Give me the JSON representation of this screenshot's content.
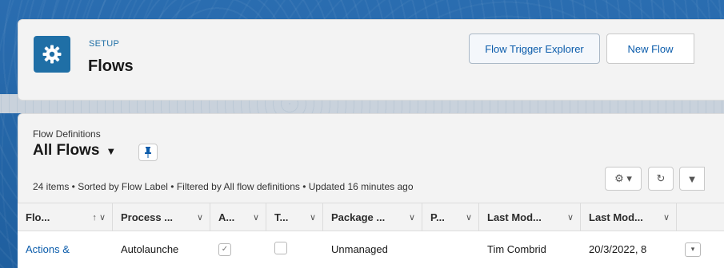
{
  "header": {
    "section_label": "SETUP",
    "title": "Flows",
    "buttons": {
      "trigger_explorer": "Flow Trigger Explorer",
      "new_flow": "New Flow"
    }
  },
  "list_view": {
    "object_label": "Flow Definitions",
    "title": "All Flows",
    "caret": "▼",
    "pin_icon": "📌",
    "meta": "24 items • Sorted by Flow Label • Filtered by All flow definitions • Updated 16 minutes ago",
    "tools": {
      "gear": "⚙ ▾",
      "refresh": "↻",
      "filter": "▼"
    }
  },
  "table": {
    "columns": [
      {
        "label": "Flo...",
        "sort": "↑",
        "chev": "∨"
      },
      {
        "label": "Process ...",
        "chev": "∨"
      },
      {
        "label": "A...",
        "chev": "∨"
      },
      {
        "label": "T...",
        "chev": "∨"
      },
      {
        "label": "Package ...",
        "chev": "∨"
      },
      {
        "label": "P...",
        "chev": "∨"
      },
      {
        "label": "Last Mod...",
        "chev": "∨"
      },
      {
        "label": "Last Mod...",
        "chev": "∨"
      }
    ],
    "rows": [
      {
        "flow_label": "Actions &",
        "process_type": "Autolaunche",
        "active_check": "✓",
        "package_state": "Unmanaged",
        "last_modified_by": "Tim Combrid",
        "last_modified_date": "20/3/2022, 8",
        "row_action": "▾"
      }
    ]
  },
  "colors": {
    "accent": "#0b5cab",
    "icon_bg": "#1f6fa6",
    "background": "#1b5f9e"
  }
}
